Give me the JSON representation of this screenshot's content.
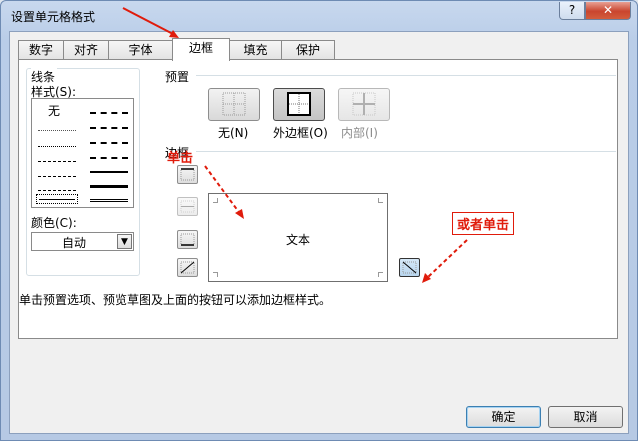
{
  "window": {
    "title": "设置单元格格式",
    "help_glyph": "?",
    "close_glyph": "✕"
  },
  "tabs": [
    {
      "label": "数字"
    },
    {
      "label": "对齐"
    },
    {
      "label": "字体"
    },
    {
      "label": "边框"
    },
    {
      "label": "填充"
    },
    {
      "label": "保护"
    }
  ],
  "line_group": {
    "title": "线条",
    "style_label": "样式(S):",
    "style_none": "无",
    "color_label": "颜色(C):",
    "color_value": "自动"
  },
  "presets": {
    "title": "预置",
    "none_label": "无(N)",
    "outline_label": "外边框(O)",
    "inside_label": "内部(I)"
  },
  "border": {
    "title": "边框",
    "preview_text": "文本"
  },
  "hint": "单击预置选项、预览草图及上面的按钮可以添加边框样式。",
  "buttons": {
    "ok": "确定",
    "cancel": "取消"
  },
  "annotations": {
    "click": "单击",
    "or_click": "或者单击"
  },
  "colors": {
    "annotation_red": "#e01b0b"
  }
}
